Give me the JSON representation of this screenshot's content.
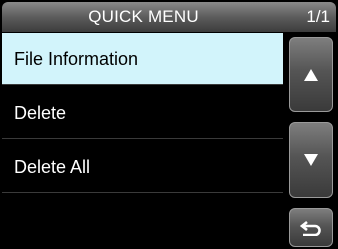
{
  "header": {
    "title": "QUICK MENU",
    "page_indicator": "1/1"
  },
  "menu": {
    "items": [
      {
        "label": "File Information",
        "selected": true
      },
      {
        "label": "Delete",
        "selected": false
      },
      {
        "label": "Delete All",
        "selected": false
      },
      {
        "label": "",
        "selected": false
      }
    ]
  },
  "icons": {
    "up": "triangle-up-icon",
    "down": "triangle-down-icon",
    "back": "return-arrow-icon"
  },
  "colors": {
    "selected_bg": "#d2f4fb",
    "background": "#000000",
    "text": "#ffffff"
  }
}
